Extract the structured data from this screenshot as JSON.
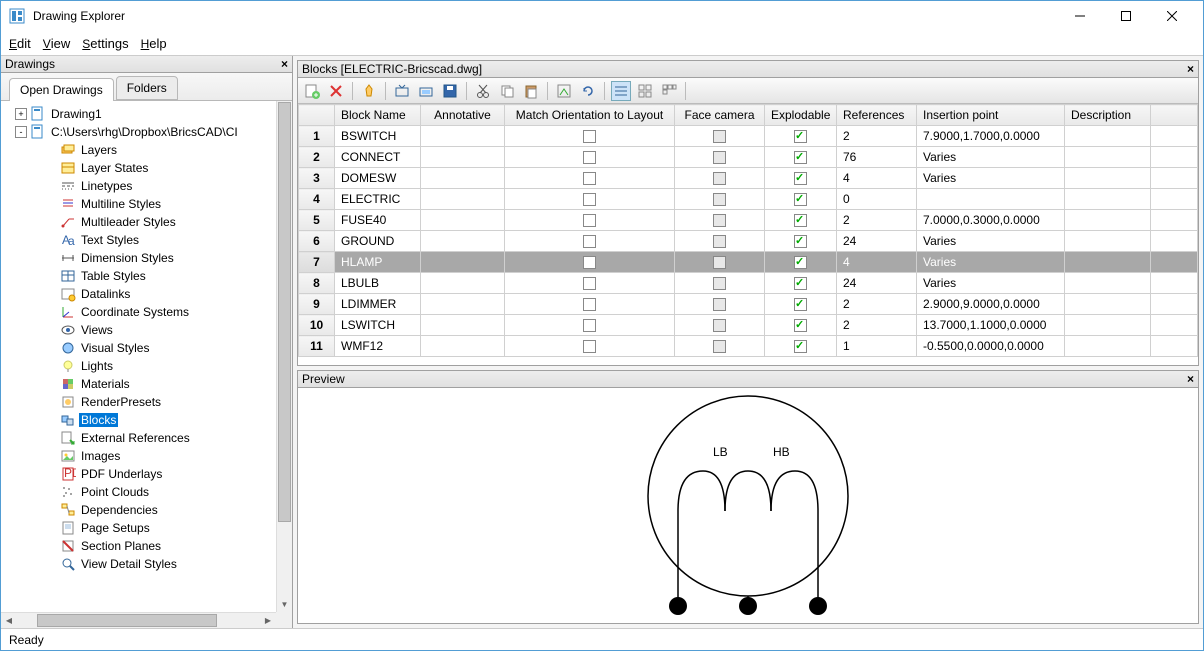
{
  "window": {
    "title": "Drawing Explorer"
  },
  "menu": {
    "edit": "Edit",
    "view": "View",
    "settings": "Settings",
    "help": "Help"
  },
  "drawings_panel": {
    "title": "Drawings",
    "tabs": {
      "open": "Open Drawings",
      "folders": "Folders"
    },
    "tree": [
      {
        "indent": 0,
        "expander": "+",
        "icon": "drawing",
        "label": "Drawing1"
      },
      {
        "indent": 0,
        "expander": "-",
        "icon": "drawing",
        "label": "C:\\Users\\rhg\\Dropbox\\BricsCAD\\CI"
      },
      {
        "indent": 1,
        "icon": "layers",
        "label": "Layers"
      },
      {
        "indent": 1,
        "icon": "layerstates",
        "label": "Layer States"
      },
      {
        "indent": 1,
        "icon": "linetypes",
        "label": "Linetypes"
      },
      {
        "indent": 1,
        "icon": "mlstyles",
        "label": "Multiline Styles"
      },
      {
        "indent": 1,
        "icon": "mleader",
        "label": "Multileader Styles"
      },
      {
        "indent": 1,
        "icon": "text",
        "label": "Text Styles"
      },
      {
        "indent": 1,
        "icon": "dim",
        "label": "Dimension Styles"
      },
      {
        "indent": 1,
        "icon": "table",
        "label": "Table Styles"
      },
      {
        "indent": 1,
        "icon": "datalink",
        "label": "Datalinks"
      },
      {
        "indent": 1,
        "icon": "coord",
        "label": "Coordinate Systems"
      },
      {
        "indent": 1,
        "icon": "views",
        "label": "Views"
      },
      {
        "indent": 1,
        "icon": "visual",
        "label": "Visual Styles"
      },
      {
        "indent": 1,
        "icon": "lights",
        "label": "Lights"
      },
      {
        "indent": 1,
        "icon": "materials",
        "label": "Materials"
      },
      {
        "indent": 1,
        "icon": "render",
        "label": "RenderPresets"
      },
      {
        "indent": 1,
        "icon": "blocks",
        "label": "Blocks",
        "selected": true
      },
      {
        "indent": 1,
        "icon": "xref",
        "label": "External References"
      },
      {
        "indent": 1,
        "icon": "images",
        "label": "Images"
      },
      {
        "indent": 1,
        "icon": "pdf",
        "label": "PDF Underlays"
      },
      {
        "indent": 1,
        "icon": "pointcloud",
        "label": "Point Clouds"
      },
      {
        "indent": 1,
        "icon": "deps",
        "label": "Dependencies"
      },
      {
        "indent": 1,
        "icon": "pagesetup",
        "label": "Page Setups"
      },
      {
        "indent": 1,
        "icon": "section",
        "label": "Section Planes"
      },
      {
        "indent": 1,
        "icon": "viewdetail",
        "label": "View Detail Styles"
      }
    ]
  },
  "blocks_panel": {
    "title": "Blocks [ELECTRIC-Bricscad.dwg]",
    "columns": [
      "",
      "Block Name",
      "Annotative",
      "Match Orientation to Layout",
      "Face camera",
      "Explodable",
      "References",
      "Insertion point",
      "Description"
    ],
    "rows": [
      {
        "n": "1",
        "name": "BSWITCH",
        "face": "grey",
        "expl": true,
        "refs": "2",
        "ins": "7.9000,1.7000,0.0000"
      },
      {
        "n": "2",
        "name": "CONNECT",
        "face": "grey",
        "expl": true,
        "refs": "76",
        "ins": "Varies"
      },
      {
        "n": "3",
        "name": "DOMESW",
        "face": "grey",
        "expl": true,
        "refs": "4",
        "ins": "Varies"
      },
      {
        "n": "4",
        "name": "ELECTRIC",
        "face": "grey",
        "expl": true,
        "refs": "0",
        "ins": ""
      },
      {
        "n": "5",
        "name": "FUSE40",
        "face": "grey",
        "expl": true,
        "refs": "2",
        "ins": "7.0000,0.3000,0.0000"
      },
      {
        "n": "6",
        "name": "GROUND",
        "face": "grey",
        "expl": true,
        "refs": "24",
        "ins": "Varies"
      },
      {
        "n": "7",
        "name": "HLAMP",
        "face": "grey",
        "expl": true,
        "refs": "4",
        "ins": "Varies",
        "selected": true
      },
      {
        "n": "8",
        "name": "LBULB",
        "face": "grey",
        "expl": true,
        "refs": "24",
        "ins": "Varies"
      },
      {
        "n": "9",
        "name": "LDIMMER",
        "face": "grey",
        "expl": true,
        "refs": "2",
        "ins": "2.9000,9.0000,0.0000"
      },
      {
        "n": "10",
        "name": "LSWITCH",
        "face": "grey",
        "expl": true,
        "refs": "2",
        "ins": "13.7000,1.1000,0.0000"
      },
      {
        "n": "11",
        "name": "WMF12",
        "face": "grey",
        "expl": true,
        "refs": "1",
        "ins": "-0.5500,0.0000,0.0000"
      }
    ]
  },
  "preview_panel": {
    "title": "Preview",
    "lb": "LB",
    "hb": "HB"
  },
  "status": {
    "text": "Ready"
  }
}
